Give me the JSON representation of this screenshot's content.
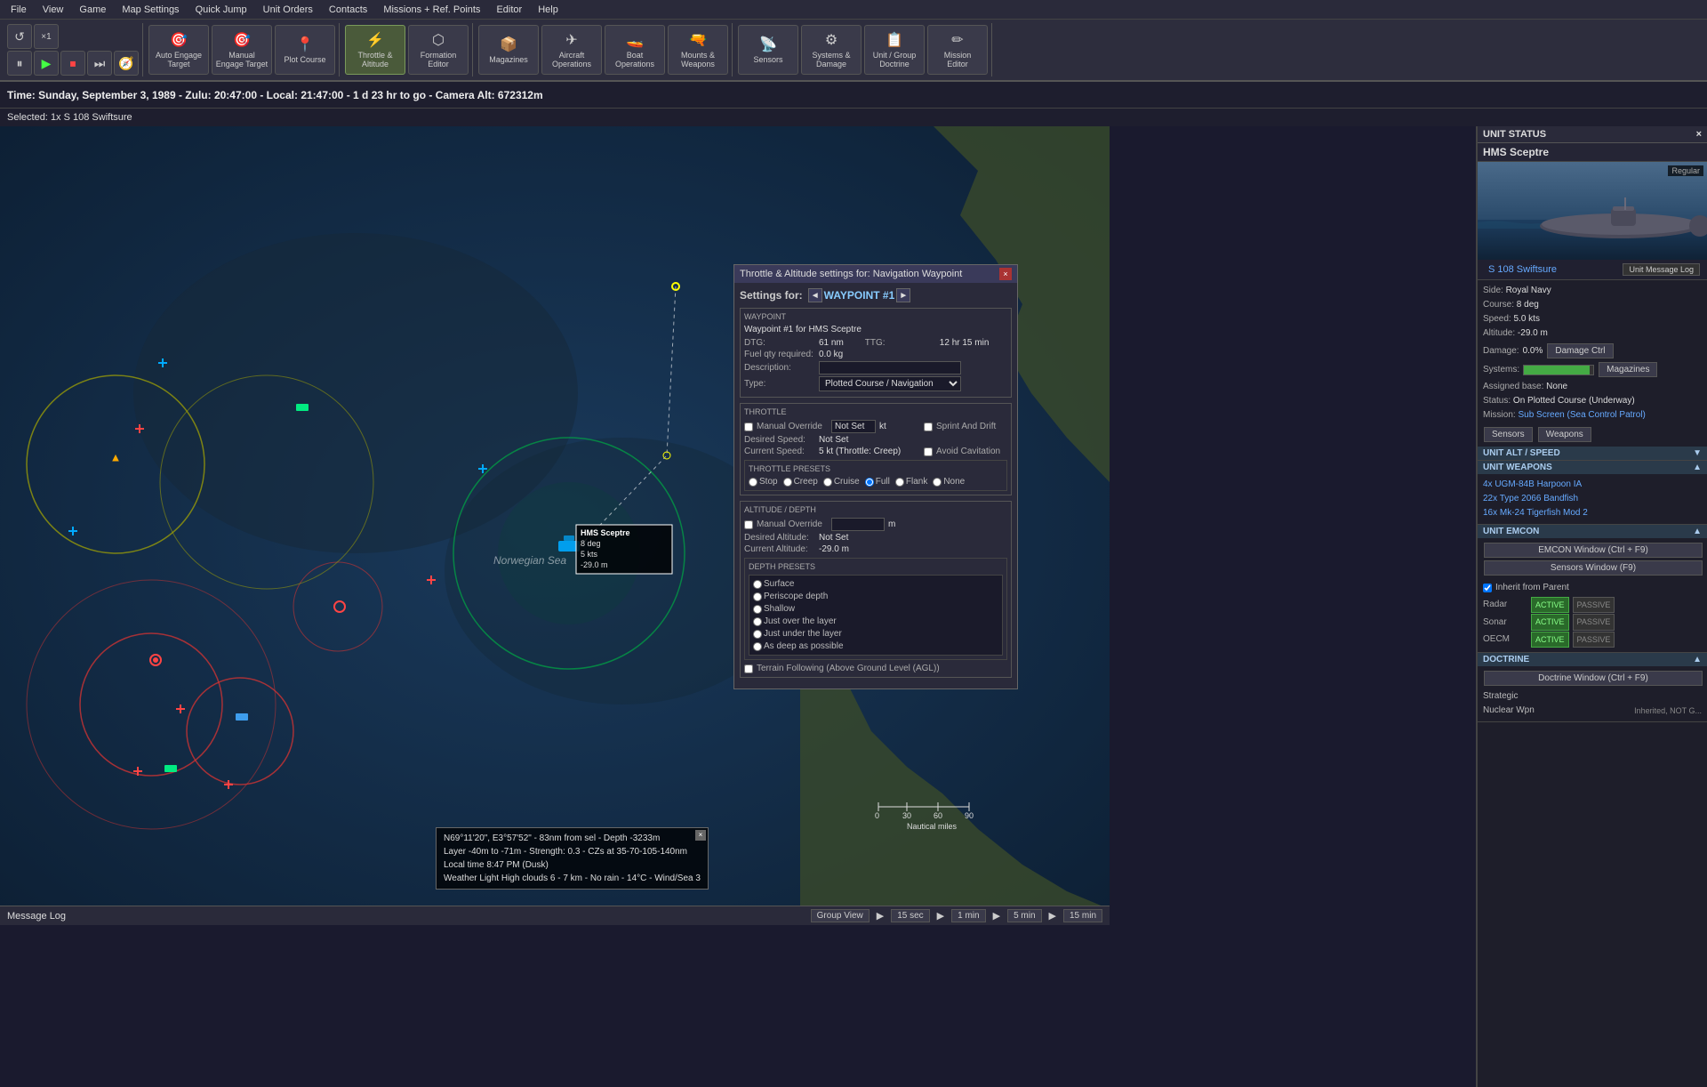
{
  "menubar": {
    "items": [
      "File",
      "View",
      "Game",
      "Map Settings",
      "Quick Jump",
      "Unit Orders",
      "Contacts",
      "Missions + Ref. Points",
      "Editor",
      "Help"
    ]
  },
  "toolbar": {
    "controls": {
      "loop_label": "×1"
    },
    "buttons": [
      {
        "id": "auto-engage",
        "label": "Auto Engage\nTarget",
        "icon": "🎯"
      },
      {
        "id": "manual-engage",
        "label": "Manual\nEngage Target",
        "icon": "🎯"
      },
      {
        "id": "plot-course",
        "label": "Plot Course",
        "icon": "📍"
      },
      {
        "id": "throttle-altitude",
        "label": "Throttle &\nAltitude",
        "icon": "⚡"
      },
      {
        "id": "formation-editor",
        "label": "Formation\nEditor",
        "icon": "⬡"
      },
      {
        "id": "magazines",
        "label": "Magazines",
        "icon": "📦"
      },
      {
        "id": "aircraft-ops",
        "label": "Aircraft\nOperations",
        "icon": "✈"
      },
      {
        "id": "boat-ops",
        "label": "Boat\nOperations",
        "icon": "🚤"
      },
      {
        "id": "mounts-weapons",
        "label": "Mounts &\nWeapons",
        "icon": "🔫"
      },
      {
        "id": "sensors",
        "label": "Sensors",
        "icon": "📡"
      },
      {
        "id": "systems-damage",
        "label": "Systems &\nDamage",
        "icon": "⚙"
      },
      {
        "id": "unit-group-doctrine",
        "label": "Unit / Group\nDoctrine",
        "icon": "📋"
      },
      {
        "id": "mission-editor",
        "label": "Mission\nEditor",
        "icon": "✏"
      }
    ]
  },
  "statusbar": {
    "time_text": "Time: Sunday, September 3, 1989 - Zulu: 20:47:00 - Local: 21:47:00 - 1 d 23 hr to go  -  Camera Alt: 672312m"
  },
  "selected_info": {
    "line1": "Selected:",
    "line2": "1x S 108 Swiftsure"
  },
  "map": {
    "region": "Norwegian Sea",
    "ship_label": "HMS Sceptre",
    "ship_course": "8 deg",
    "ship_speed": "5 kts",
    "ship_depth": "-29.0 m",
    "info_overlay": {
      "line1": "N69°11'20\", E3°57'52\" - 83nm from sel - Depth -3233m",
      "line2": "Layer -40m to -71m - Strength: 0.3 - CZs at 35-70-105-140nm",
      "line3": "Local time 8:47 PM (Dusk)",
      "line4": "Weather Light High clouds 6 - 7 km - No rain - 14°C - Wind/Sea 3"
    },
    "scale": {
      "labels": [
        "0",
        "30",
        "60",
        "90"
      ],
      "unit": "Nautical miles"
    }
  },
  "throttle_dialog": {
    "title": "Throttle & Altitude settings for: Navigation Waypoint",
    "settings_for_label": "Settings for:",
    "waypoint_name": "WAYPOINT #1",
    "waypoint_section": {
      "title": "WAYPOINT",
      "description_label": "Waypoint #1 for HMS Sceptre",
      "dtg_label": "DTG:",
      "dtg_value": "61 nm",
      "ttg_label": "TTG:",
      "ttg_value": "12 hr 15 min",
      "fuel_label": "Fuel qty required:",
      "fuel_value": "0.0 kg",
      "desc_field_label": "Description:",
      "desc_field_value": "",
      "type_label": "Type:",
      "type_value": "Plotted Course / Navigation"
    },
    "throttle_section": {
      "title": "THROTTLE",
      "manual_override_label": "Manual Override",
      "manual_override_checked": false,
      "unit_label": "kt",
      "sprint_drift_label": "Sprint And Drift",
      "sprint_drift_checked": false,
      "desired_speed_label": "Desired Speed:",
      "desired_speed_value": "Not Set",
      "current_speed_label": "Current Speed:",
      "current_speed_value": "5 kt (Throttle: Creep)",
      "avoid_cavitation_label": "Avoid Cavitation",
      "avoid_cavitation_checked": false,
      "presets_title": "Throttle Presets",
      "presets": [
        "Stop",
        "Creep",
        "Cruise",
        "Full",
        "Flank",
        "None"
      ],
      "preset_selected": "Full"
    },
    "altitude_section": {
      "title": "ALTITUDE / DEPTH",
      "manual_override_label": "Manual Override",
      "manual_override_checked": false,
      "unit_label": "m",
      "desired_altitude_label": "Desired Altitude:",
      "desired_altitude_value": "Not Set",
      "current_altitude_label": "Current Altitude:",
      "current_altitude_value": "-29.0 m",
      "depth_presets_title": "Depth Presets",
      "depth_presets": [
        "Surface",
        "Periscope depth",
        "Shallow",
        "Just over the layer",
        "Just under the layer",
        "As deep as possible"
      ],
      "depth_selected": "",
      "terrain_following_label": "Terrain Following (Above Ground Level (AGL))",
      "terrain_following_checked": false
    }
  },
  "right_panel": {
    "header": "UNIT STATUS",
    "close_btn": "×",
    "unit_name": "HMS Sceptre",
    "regular_label": "Regular",
    "unit_name_link": "S 108 Swiftsure",
    "msg_log_btn": "Unit Message Log",
    "side_label": "Side:",
    "side_value": "Royal Navy",
    "course_label": "Course:",
    "course_value": "8 deg",
    "speed_label": "Speed:",
    "speed_value": "5.0 kts",
    "altitude_label": "Altitude:",
    "altitude_value": "-29.0 m",
    "damage_label": "Damage:",
    "damage_value": "0.0%",
    "damage_btn": "Damage Ctrl",
    "systems_label": "Systems:",
    "magazines_btn": "Magazines",
    "assigned_base_label": "Assigned base:",
    "assigned_base_value": "None",
    "status_label": "Status:",
    "status_value": "On Plotted Course (Underway)",
    "mission_label": "Mission:",
    "mission_value": "Sub Screen (Sea Control Patrol)",
    "sensors_btn": "Sensors",
    "weapons_btn": "Weapons",
    "unit_alt_speed_header": "UNIT ALT / SPEED",
    "unit_weapons_header": "UNIT WEAPONS",
    "weapons_list": [
      "4x UGM-84B Harpoon IA",
      "22x Type 2066 Bandfish",
      "16x Mk-24 Tigerfish Mod 2"
    ],
    "unit_emcon_header": "UNIT EMCON",
    "emcon_window_btn": "EMCON Window (Ctrl + F9)",
    "sensors_window_btn": "Sensors Window (F9)",
    "inherit_parent_label": "Inherit from Parent",
    "inherit_parent_checked": true,
    "radar_label": "Radar",
    "radar_active": "ACTIVE",
    "radar_passive": "PASSIVE",
    "sonar_label": "Sonar",
    "sonar_active": "ACTIVE",
    "sonar_passive": "PASSIVE",
    "oecm_label": "OECM",
    "oecm_active": "ACTIVE",
    "oecm_passive": "PASSIVE",
    "doctrine_header": "DOCTRINE",
    "doctrine_window_btn": "Doctrine Window (Ctrl + F9)",
    "strategic_label": "Strategic",
    "nuclear_wpn_label": "Nuclear Wpn",
    "nuclear_wpn_value": "Inherited, NOT G..."
  },
  "bottombar": {
    "message_log_label": "Message Log",
    "group_view_label": "Group View",
    "time_steps": [
      "15 sec",
      "1 min",
      "5 min",
      "15 min"
    ]
  }
}
